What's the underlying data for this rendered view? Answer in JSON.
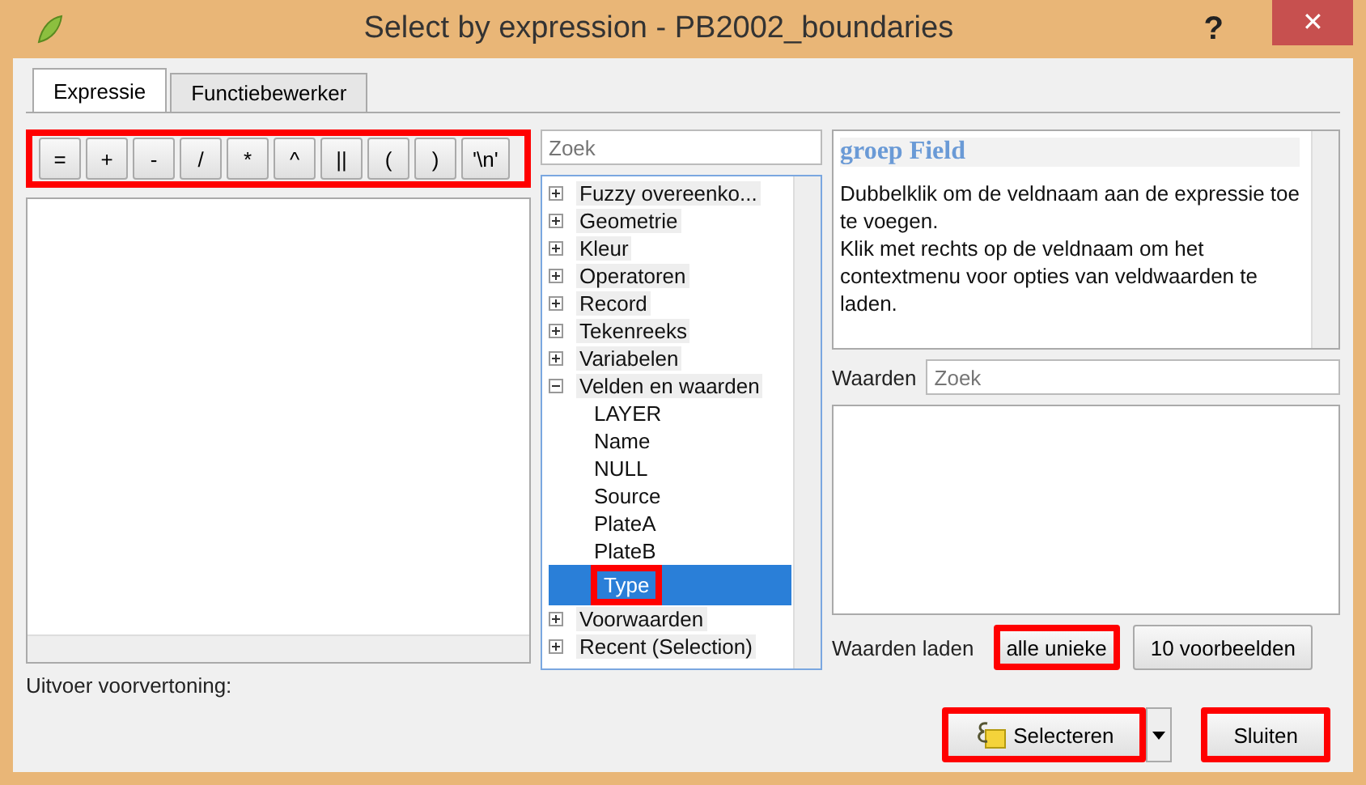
{
  "window": {
    "title": "Select by expression - PB2002_boundaries",
    "help": "?",
    "close": "✕"
  },
  "tabs": [
    {
      "label": "Expressie",
      "selected": true
    },
    {
      "label": "Functiebewerker",
      "selected": false
    }
  ],
  "operators": {
    "highlighted": true,
    "buttons": [
      "=",
      "+",
      "-",
      "/",
      "*",
      "^",
      "||",
      "(",
      ")",
      "'\\n'"
    ]
  },
  "function_search": {
    "placeholder": "Zoek"
  },
  "tree": [
    {
      "label": "Fuzzy overeenko...",
      "expanded": false
    },
    {
      "label": "Geometrie",
      "expanded": false
    },
    {
      "label": "Kleur",
      "expanded": false
    },
    {
      "label": "Operatoren",
      "expanded": false
    },
    {
      "label": "Record",
      "expanded": false
    },
    {
      "label": "Tekenreeks",
      "expanded": false
    },
    {
      "label": "Variabelen",
      "expanded": false
    },
    {
      "label": "Velden en waarden",
      "expanded": true,
      "children": [
        {
          "label": "LAYER",
          "selected": false,
          "highlighted": false
        },
        {
          "label": "Name",
          "selected": false,
          "highlighted": false
        },
        {
          "label": "NULL",
          "selected": false,
          "highlighted": false
        },
        {
          "label": "Source",
          "selected": false,
          "highlighted": false
        },
        {
          "label": "PlateA",
          "selected": false,
          "highlighted": false
        },
        {
          "label": "PlateB",
          "selected": false,
          "highlighted": false
        },
        {
          "label": "Type",
          "selected": true,
          "highlighted": true
        }
      ]
    },
    {
      "label": "Voorwaarden",
      "expanded": false
    },
    {
      "label": "Recent (Selection)",
      "expanded": false
    }
  ],
  "help": {
    "title": "groep Field",
    "lines": [
      "Dubbelklik om de veldnaam aan de expressie toe te voegen.",
      "Klik met rechts op de veldnaam om het contextmenu voor opties van veldwaarden te laden."
    ]
  },
  "values": {
    "label": "Waarden",
    "placeholder": "Zoek"
  },
  "load_values": {
    "label": "Waarden laden",
    "buttons": [
      {
        "label": "alle unieke",
        "highlighted": true
      },
      {
        "label": "10 voorbeelden",
        "highlighted": false
      }
    ]
  },
  "preview": {
    "label": "Uitvoer voorvertoning:"
  },
  "footer": [
    {
      "kind": "split",
      "label": "Selecteren",
      "highlighted": true
    },
    {
      "kind": "plain",
      "label": "Sluiten",
      "highlighted": true
    }
  ]
}
